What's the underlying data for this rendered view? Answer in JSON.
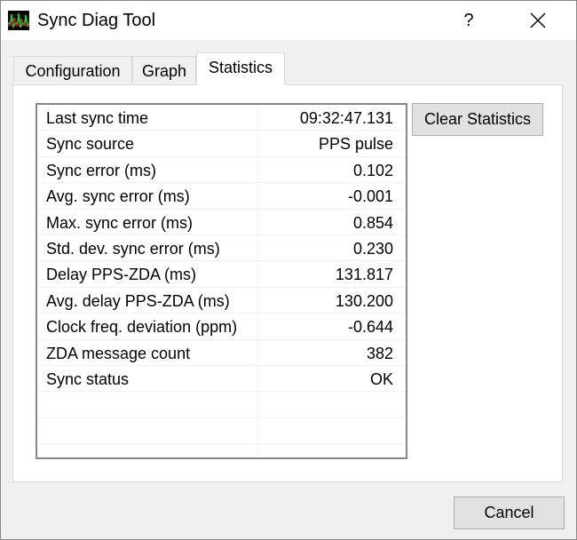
{
  "window": {
    "title": "Sync Diag Tool",
    "help_label": "?"
  },
  "tabs": [
    {
      "label": "Configuration",
      "active": false
    },
    {
      "label": "Graph",
      "active": false
    },
    {
      "label": "Statistics",
      "active": true
    }
  ],
  "statistics": {
    "rows": [
      {
        "name": "Last sync time",
        "value": "09:32:47.131"
      },
      {
        "name": "Sync source",
        "value": "PPS pulse"
      },
      {
        "name": "Sync error (ms)",
        "value": "0.102"
      },
      {
        "name": "Avg. sync error (ms)",
        "value": "-0.001"
      },
      {
        "name": "Max. sync error (ms)",
        "value": "0.854"
      },
      {
        "name": "Std. dev. sync error (ms)",
        "value": "0.230"
      },
      {
        "name": "Delay PPS-ZDA (ms)",
        "value": "131.817"
      },
      {
        "name": "Avg. delay PPS-ZDA (ms)",
        "value": "130.200"
      },
      {
        "name": "Clock freq. deviation (ppm)",
        "value": "-0.644"
      },
      {
        "name": "ZDA message count",
        "value": "382"
      },
      {
        "name": "Sync status",
        "value": "OK"
      }
    ]
  },
  "buttons": {
    "clear_statistics": "Clear Statistics",
    "cancel": "Cancel"
  },
  "icons": {
    "app": "signal-waveform-icon",
    "close": "close-icon"
  }
}
